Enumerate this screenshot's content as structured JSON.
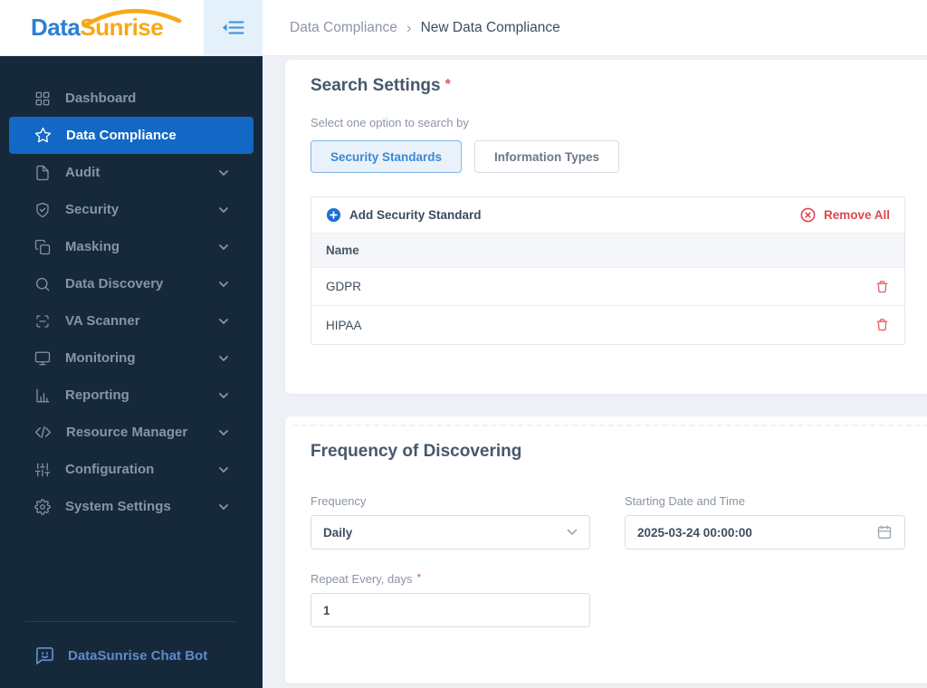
{
  "brand": {
    "name_part1": "Data",
    "name_part2": "Sunrise"
  },
  "breadcrumb": {
    "parent": "Data Compliance",
    "separator": "›",
    "current": "New Data Compliance"
  },
  "sidebar": {
    "items": [
      {
        "label": "Dashboard",
        "icon": "dashboard-grid-icon",
        "active": false,
        "has_submenu": false
      },
      {
        "label": "Data Compliance",
        "icon": "star-icon",
        "active": true,
        "has_submenu": false
      },
      {
        "label": "Audit",
        "icon": "document-icon",
        "active": false,
        "has_submenu": true
      },
      {
        "label": "Security",
        "icon": "shield-check-icon",
        "active": false,
        "has_submenu": true
      },
      {
        "label": "Masking",
        "icon": "mask-copy-icon",
        "active": false,
        "has_submenu": true
      },
      {
        "label": "Data Discovery",
        "icon": "search-icon",
        "active": false,
        "has_submenu": true
      },
      {
        "label": "VA Scanner",
        "icon": "scanner-icon",
        "active": false,
        "has_submenu": true
      },
      {
        "label": "Monitoring",
        "icon": "monitor-icon",
        "active": false,
        "has_submenu": true
      },
      {
        "label": "Reporting",
        "icon": "bar-chart-icon",
        "active": false,
        "has_submenu": true
      },
      {
        "label": "Resource Manager",
        "icon": "code-icon",
        "active": false,
        "has_submenu": true
      },
      {
        "label": "Configuration",
        "icon": "sliders-icon",
        "active": false,
        "has_submenu": true
      },
      {
        "label": "System Settings",
        "icon": "gear-icon",
        "active": false,
        "has_submenu": true
      }
    ],
    "chat_bot": {
      "label": "DataSunrise Chat Bot",
      "icon": "chat-bubble-icon"
    }
  },
  "search_settings_card": {
    "title": "Search Settings",
    "required_mark": "*",
    "select_option_label": "Select one option to search by",
    "search_by_options": [
      {
        "label": "Security Standards",
        "selected": true
      },
      {
        "label": "Information Types",
        "selected": false
      }
    ],
    "standards_table": {
      "add_button_label": "Add Security Standard",
      "remove_all_label": "Remove All",
      "header": "Name",
      "rows": [
        "GDPR",
        "HIPAA"
      ]
    }
  },
  "frequency_card": {
    "title": "Frequency of Discovering",
    "frequency_field": {
      "label": "Frequency",
      "value": "Daily"
    },
    "start_field": {
      "label": "Starting Date and Time",
      "value": "2025-03-24 00:00:00"
    },
    "repeat_field": {
      "label": "Repeat Every, days",
      "required_mark": "*",
      "value": "1"
    }
  },
  "colors": {
    "sidebar_bg": "#16293a",
    "active_nav_bg": "#1268c4",
    "accent_blue": "#1e6fd2",
    "danger_red": "#e0464d",
    "logo_blue": "#2e7fd1",
    "logo_orange": "#f7a915",
    "content_bg": "#edf1f5"
  }
}
